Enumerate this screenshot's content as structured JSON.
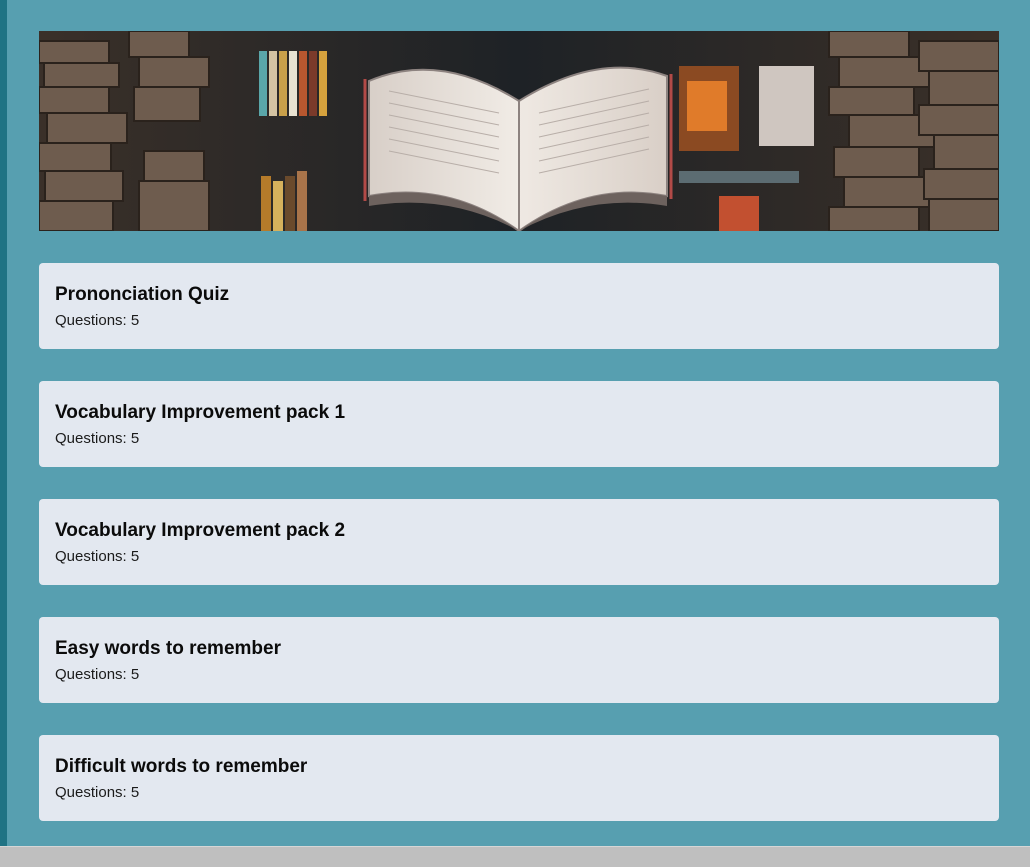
{
  "hero": {
    "icon": "open-book-library-banner"
  },
  "quizzes": [
    {
      "title": "Prononciation Quiz",
      "questions": "Questions: 5"
    },
    {
      "title": "Vocabulary Improvement pack 1",
      "questions": "Questions: 5"
    },
    {
      "title": "Vocabulary Improvement pack 2",
      "questions": "Questions: 5"
    },
    {
      "title": "Easy words to remember",
      "questions": "Questions: 5"
    },
    {
      "title": "Difficult words to remember",
      "questions": "Questions: 5"
    }
  ],
  "colors": {
    "page_background": "#579fb0",
    "card_background": "#e3e8f0",
    "left_edge": "#1f7384"
  }
}
